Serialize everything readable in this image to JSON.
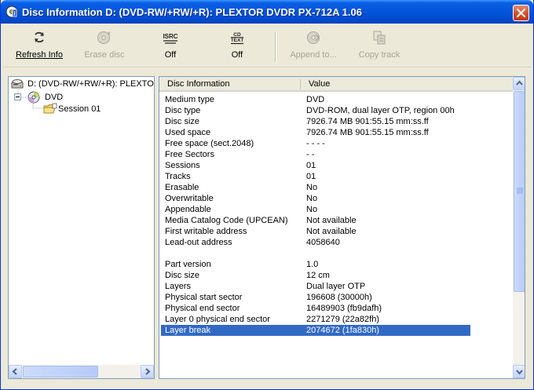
{
  "window": {
    "title": "Disc Information  D: (DVD-RW/+RW/+R):  PLEXTOR DVDR   PX-712A 1.06"
  },
  "toolbar": {
    "refresh_label": "Refresh Info",
    "erase_label": "Erase disc",
    "isrc_label": "Off",
    "isrc_icon_text": "ISRC",
    "cdtext_label": "Off",
    "cdtext_icon_text_top": "CD",
    "cdtext_icon_text_bottom": "TEXT",
    "append_label": "Append to...",
    "copy_label": "Copy track"
  },
  "tree": {
    "drive_label": "D: (DVD-RW/+RW/+R):  PLEXTOR",
    "disc_label": "DVD",
    "session_label": "Session 01"
  },
  "list": {
    "headers": {
      "info": "Disc Information",
      "value": "Value"
    },
    "rows": [
      {
        "name": "Medium type",
        "value": "DVD"
      },
      {
        "name": "Disc type",
        "value": "DVD-ROM, dual layer OTP, region 00h"
      },
      {
        "name": "Disc size",
        "value": "7926.74 MB   901:55.15 mm:ss.ff"
      },
      {
        "name": "Used space",
        "value": "7926.74 MB   901:55.15 mm:ss.ff"
      },
      {
        "name": "Free space (sect.2048)",
        "value": "- -   - -"
      },
      {
        "name": "Free Sectors",
        "value": "- -"
      },
      {
        "name": "Sessions",
        "value": "01"
      },
      {
        "name": "Tracks",
        "value": "01"
      },
      {
        "name": "Erasable",
        "value": "No"
      },
      {
        "name": "Overwritable",
        "value": "No"
      },
      {
        "name": "Appendable",
        "value": "No"
      },
      {
        "name": "Media Catalog Code (UPCEAN)",
        "value": "Not available"
      },
      {
        "name": "First writable address",
        "value": "Not available"
      },
      {
        "name": "Lead-out address",
        "value": "4058640"
      },
      {
        "name": "",
        "value": ""
      },
      {
        "name": "Part version",
        "value": "1.0"
      },
      {
        "name": "Disc size",
        "value": "12 cm"
      },
      {
        "name": "Layers",
        "value": "Dual layer OTP"
      },
      {
        "name": "Physical start sector",
        "value": "196608 (30000h)"
      },
      {
        "name": "Physical end sector",
        "value": "16489903 (fb9dafh)"
      },
      {
        "name": "Layer 0 physical end sector",
        "value": "2271279 (22a82fh)"
      },
      {
        "name": "Layer break",
        "value": "2074672 (1fa830h)"
      }
    ],
    "selected_index": 21
  },
  "colors": {
    "title_bar": "#0355d8",
    "selection": "#316ac5",
    "window_bg": "#ece9d8"
  }
}
